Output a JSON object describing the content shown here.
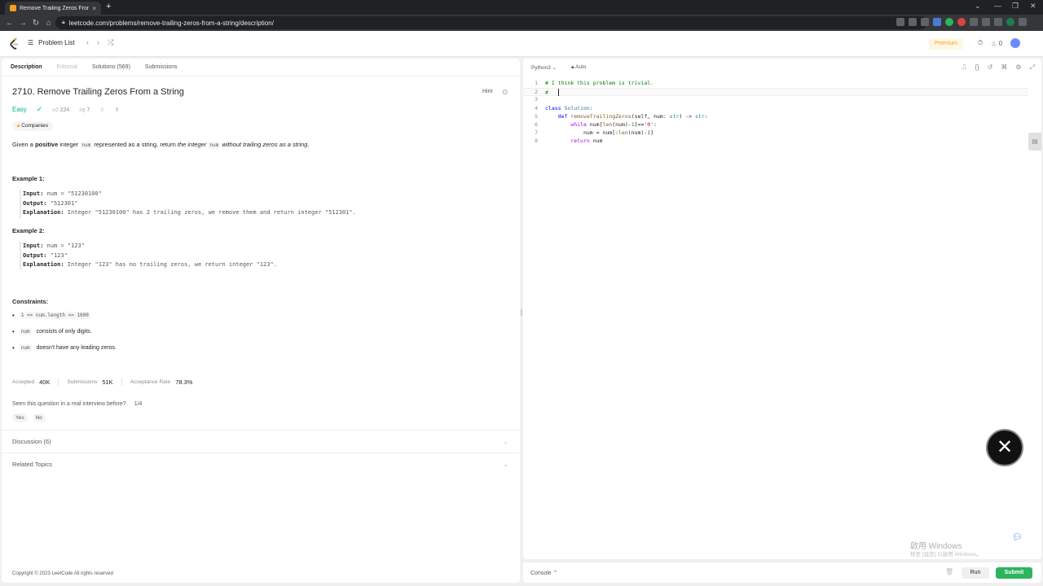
{
  "browser": {
    "tab_title": "Remove Trailing Zeros From a",
    "tab_close": "×",
    "new_tab": "+",
    "url": "leetcode.com/problems/remove-trailing-zeros-from-a-string/description/"
  },
  "nav": {
    "problem_list": "Problem List",
    "premium": "Premium",
    "streak": "0"
  },
  "left_tabs": [
    "Description",
    "Editorial",
    "Solutions (569)",
    "Submissions"
  ],
  "question": {
    "title": "2710. Remove Trailing Zeros From a String",
    "hint": "Hint",
    "difficulty": "Easy",
    "likes": "224",
    "dislikes": "7",
    "companies": "Companies",
    "desc_1": "Given a ",
    "desc_bold": "positive",
    "desc_2": " integer ",
    "desc_code1": "num",
    "desc_3": " represented as a string, return ",
    "desc_em1": "the integer ",
    "desc_code2": "num",
    "desc_em2": " without trailing zeros as a string",
    "desc_4": "."
  },
  "examples": [
    {
      "title": "Example 1:",
      "input_label": "Input:",
      "input": "num = \"51230100\"",
      "output_label": "Output:",
      "output": "\"512301\"",
      "explanation_label": "Explanation:",
      "explanation": "Integer \"51230100\" has 2 trailing zeros, we remove them and return integer \"512301\"."
    },
    {
      "title": "Example 2:",
      "input_label": "Input:",
      "input": "num = \"123\"",
      "output_label": "Output:",
      "output": "\"123\"",
      "explanation_label": "Explanation:",
      "explanation": "Integer \"123\" has no trailing zeros, we return integer \"123\"."
    }
  ],
  "constraints": {
    "title": "Constraints:",
    "c1_code": "1 <= num.length <= 1000",
    "c2_code": "num",
    "c2_text": "consists of only digits.",
    "c3_code": "num",
    "c3_text": "doesn't have any leading zeros."
  },
  "stats": {
    "accepted_label": "Accepted",
    "accepted": "40K",
    "submissions_label": "Submissions",
    "submissions": "51K",
    "rate_label": "Acceptance Rate",
    "rate": "78.3%"
  },
  "seen": {
    "question": "Seen this question in a real interview before?",
    "count": "1/4",
    "yes": "Yes",
    "no": "No"
  },
  "folds": {
    "discussion": "Discussion (6)",
    "related": "Related Topics"
  },
  "copyright": "Copyright © 2023 LeetCode All rights reserved",
  "editor": {
    "language": "Python3",
    "mode": "Auto",
    "code_lines": [
      "# I think this problem is trivial.",
      "#",
      "",
      "class Solution:",
      "    def removeTrailingZeros(self, num: str) -> str:",
      "        while num[len(num)-1]=='0':",
      "            num = num[:len(num)-1]",
      "        return num"
    ],
    "line_numbers": [
      "1",
      "2",
      "3",
      "4",
      "5",
      "6",
      "7",
      "8"
    ]
  },
  "console": {
    "label": "Console",
    "run": "Run",
    "submit": "Submit"
  },
  "watermark": {
    "line1": "啟用 Windows",
    "line2": "移至 [設定] 以啟用 Windows。"
  },
  "icons": {
    "logo": "leetcode-logo-icon",
    "fab": "x-logo-icon"
  }
}
